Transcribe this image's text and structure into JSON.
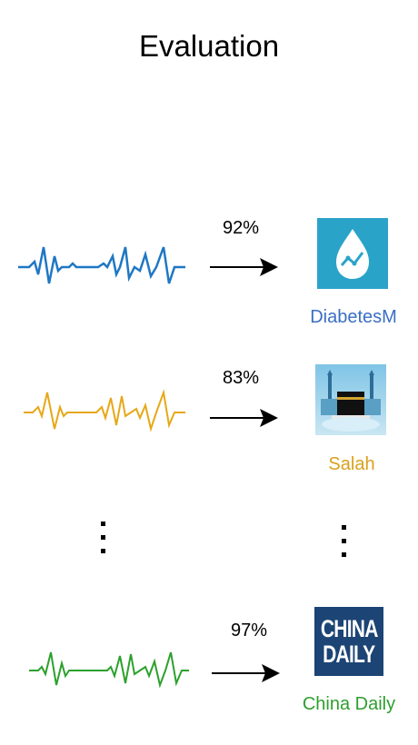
{
  "title": "Evaluation",
  "rows": [
    {
      "percent": "92%",
      "app_name": "DiabetesM",
      "color": "#1f77c4",
      "label_color": "#3a6fc4",
      "icon": "diabetes-drop-icon"
    },
    {
      "percent": "83%",
      "app_name": "Salah",
      "color": "#e6a817",
      "label_color": "#d9a11c",
      "icon": "kaaba-icon"
    },
    {
      "percent": "97%",
      "app_name": "China Daily",
      "color": "#2ca02c",
      "label_color": "#2f9e2f",
      "icon": "china-daily-logo"
    }
  ],
  "china_daily_logo": {
    "line1": "CHINA",
    "line2": "DAILY"
  }
}
